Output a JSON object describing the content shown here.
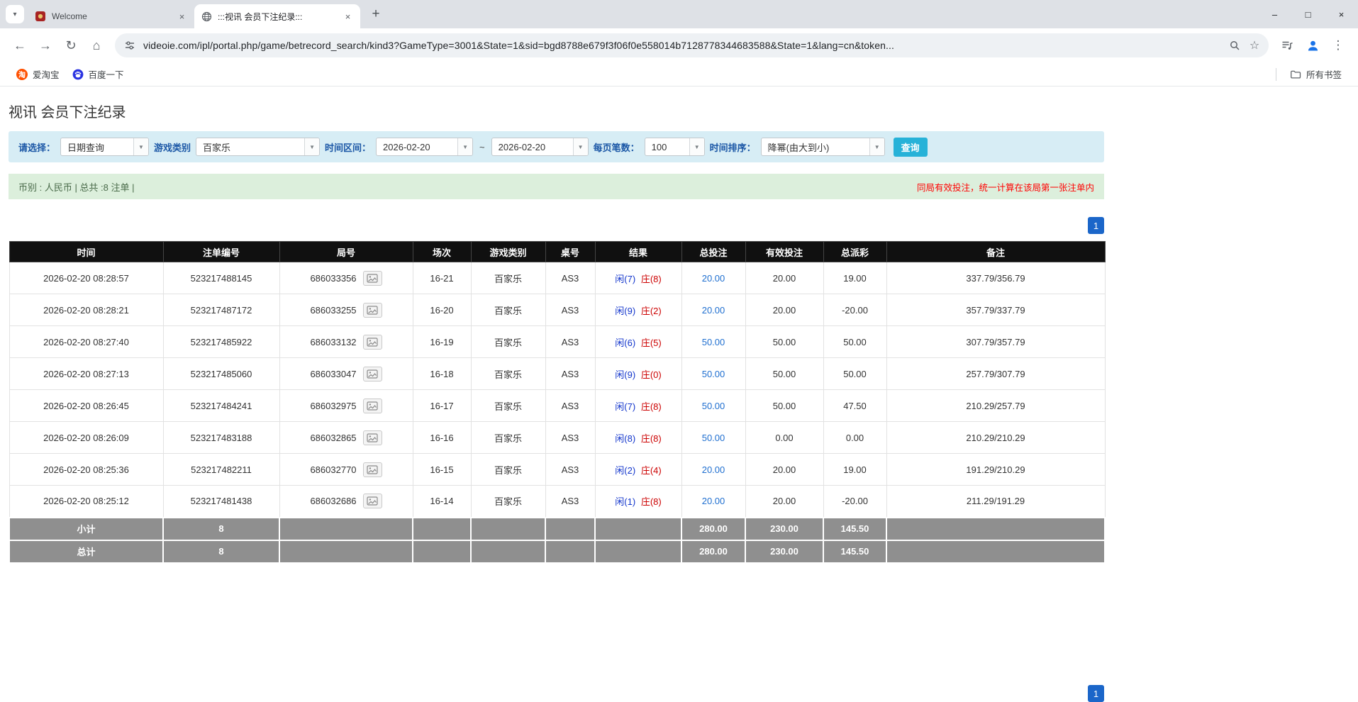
{
  "browser": {
    "tabs": [
      {
        "title": "Welcome"
      },
      {
        "title": ":::视讯 会员下注纪录:::"
      }
    ],
    "url": "videoie.com/ipl/portal.php/game/betrecord_search/kind3?GameType=3001&State=1&sid=bgd8788e679f3f06f0e558014b7128778344683588&State=1&lang=cn&token...",
    "bookmarks": [
      {
        "label": "爱淘宝"
      },
      {
        "label": "百度一下"
      }
    ],
    "all_bookmarks_label": "所有书签"
  },
  "icons": {
    "tab_list": "▾",
    "close": "×",
    "new_tab": "+",
    "minimize": "–",
    "maximize": "□",
    "window_close": "×",
    "back": "←",
    "forward": "→",
    "refresh": "↻",
    "home": "⌂",
    "star": "☆",
    "menu": "⋮",
    "dropdown": "▼",
    "taobao_glyph": "淘"
  },
  "colors": {
    "pagination_blue": "#1b66c9",
    "search_button_cyan": "#27b2d8",
    "bet_link_blue": "#1f6fd0",
    "negative_red": "#e60000",
    "player_blue": "#1336cc",
    "banker_red": "#cc0000",
    "table_header_bg": "#101010",
    "table_footer_bg": "#8f8f8f",
    "filter_bar_bg": "#d7edf5",
    "summary_bar_bg": "#dcefdc",
    "notice_red": "#ff0000"
  },
  "page": {
    "title": "视讯 会员下注纪录",
    "filter": {
      "select_label": "请选择：",
      "select_value": "日期查询",
      "game_label": "游戏类别",
      "game_value": "百家乐",
      "range_label": "时间区间：",
      "date_from": "2026-02-20",
      "range_separator": "~",
      "date_to": "2026-02-20",
      "per_page_label": "每页笔数：",
      "per_page_value": "100",
      "sort_label": "时间排序：",
      "sort_value": "降幂(由大到小)",
      "search_button": "查询"
    },
    "summary_bar": {
      "left": "币别 : 人民币 | 总共 :8 注单 |",
      "right": "同局有效投注，统一计算在该局第一张注单内"
    },
    "pagination": {
      "page": "1"
    },
    "table": {
      "headers": [
        "时间",
        "注单编号",
        "局号",
        "场次",
        "游戏类别",
        "桌号",
        "结果",
        "总投注",
        "有效投注",
        "总派彩",
        "备注"
      ],
      "rows": [
        {
          "time": "2026-02-20 08:28:57",
          "bet_id": "523217488145",
          "round_no": "686033356",
          "session": "16-21",
          "game": "百家乐",
          "table_no": "AS3",
          "result_player": "闲(7)",
          "result_banker": "庄(8)",
          "total_bet": "20.00",
          "valid_bet": "20.00",
          "payout": "19.00",
          "remark": "337.79/356.79"
        },
        {
          "time": "2026-02-20 08:28:21",
          "bet_id": "523217487172",
          "round_no": "686033255",
          "session": "16-20",
          "game": "百家乐",
          "table_no": "AS3",
          "result_player": "闲(9)",
          "result_banker": "庄(2)",
          "total_bet": "20.00",
          "valid_bet": "20.00",
          "payout": "-20.00",
          "remark": "357.79/337.79"
        },
        {
          "time": "2026-02-20 08:27:40",
          "bet_id": "523217485922",
          "round_no": "686033132",
          "session": "16-19",
          "game": "百家乐",
          "table_no": "AS3",
          "result_player": "闲(6)",
          "result_banker": "庄(5)",
          "total_bet": "50.00",
          "valid_bet": "50.00",
          "payout": "50.00",
          "remark": "307.79/357.79"
        },
        {
          "time": "2026-02-20 08:27:13",
          "bet_id": "523217485060",
          "round_no": "686033047",
          "session": "16-18",
          "game": "百家乐",
          "table_no": "AS3",
          "result_player": "闲(9)",
          "result_banker": "庄(0)",
          "total_bet": "50.00",
          "valid_bet": "50.00",
          "payout": "50.00",
          "remark": "257.79/307.79"
        },
        {
          "time": "2026-02-20 08:26:45",
          "bet_id": "523217484241",
          "round_no": "686032975",
          "session": "16-17",
          "game": "百家乐",
          "table_no": "AS3",
          "result_player": "闲(7)",
          "result_banker": "庄(8)",
          "total_bet": "50.00",
          "valid_bet": "50.00",
          "payout": "47.50",
          "remark": "210.29/257.79"
        },
        {
          "time": "2026-02-20 08:26:09",
          "bet_id": "523217483188",
          "round_no": "686032865",
          "session": "16-16",
          "game": "百家乐",
          "table_no": "AS3",
          "result_player": "闲(8)",
          "result_banker": "庄(8)",
          "total_bet": "50.00",
          "valid_bet": "0.00",
          "payout": "0.00",
          "remark": "210.29/210.29"
        },
        {
          "time": "2026-02-20 08:25:36",
          "bet_id": "523217482211",
          "round_no": "686032770",
          "session": "16-15",
          "game": "百家乐",
          "table_no": "AS3",
          "result_player": "闲(2)",
          "result_banker": "庄(4)",
          "total_bet": "20.00",
          "valid_bet": "20.00",
          "payout": "19.00",
          "remark": "191.29/210.29"
        },
        {
          "time": "2026-02-20 08:25:12",
          "bet_id": "523217481438",
          "round_no": "686032686",
          "session": "16-14",
          "game": "百家乐",
          "table_no": "AS3",
          "result_player": "闲(1)",
          "result_banker": "庄(8)",
          "total_bet": "20.00",
          "valid_bet": "20.00",
          "payout": "-20.00",
          "remark": "211.29/191.29"
        }
      ],
      "subtotal": {
        "label": "小计",
        "count": "8",
        "total_bet": "280.00",
        "valid_bet": "230.00",
        "payout": "145.50"
      },
      "grand_total": {
        "label": "总计",
        "count": "8",
        "total_bet": "280.00",
        "valid_bet": "230.00",
        "payout": "145.50"
      }
    }
  }
}
